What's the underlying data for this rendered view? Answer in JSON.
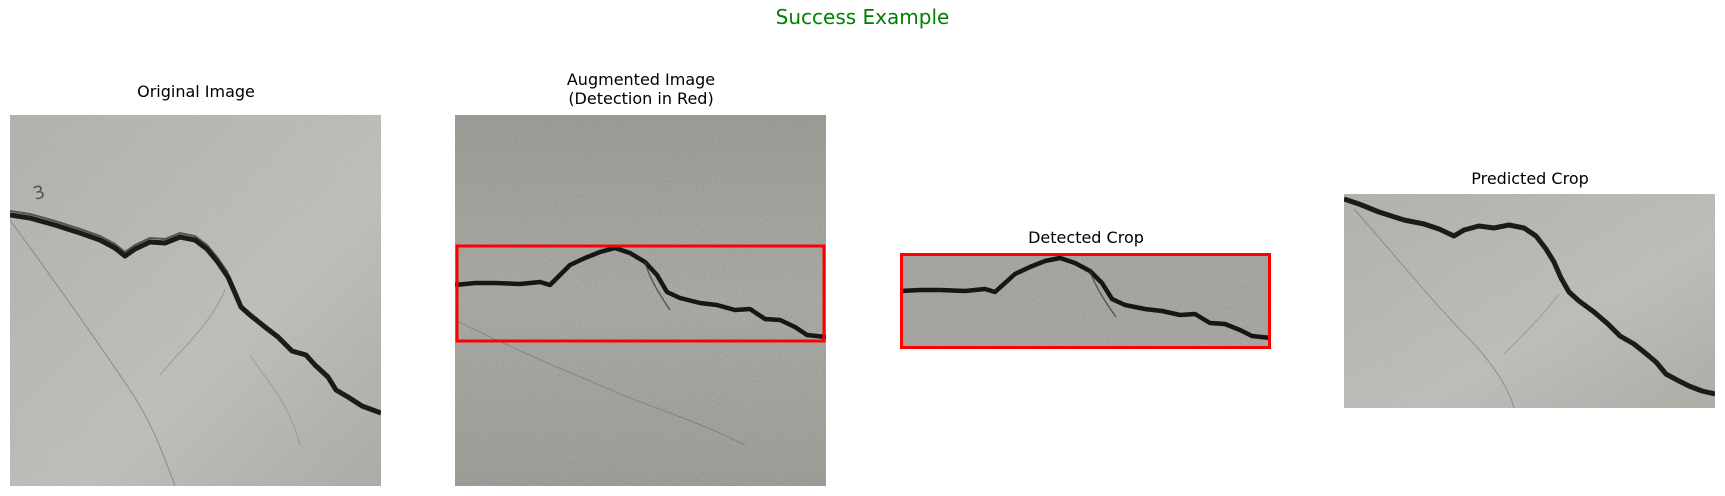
{
  "figure": {
    "title": "Success Example",
    "title_color": "#008000"
  },
  "panels": [
    {
      "title": "Original Image"
    },
    {
      "title": "Augmented Image\n(Detection in Red)"
    },
    {
      "title": "Detected Crop"
    },
    {
      "title": "Predicted Crop"
    }
  ],
  "colors": {
    "detection_box": "#ff0000",
    "crack": "#1b1b1b",
    "concrete_light": "#c2c1bd",
    "concrete_dark": "#a9a8a2"
  }
}
